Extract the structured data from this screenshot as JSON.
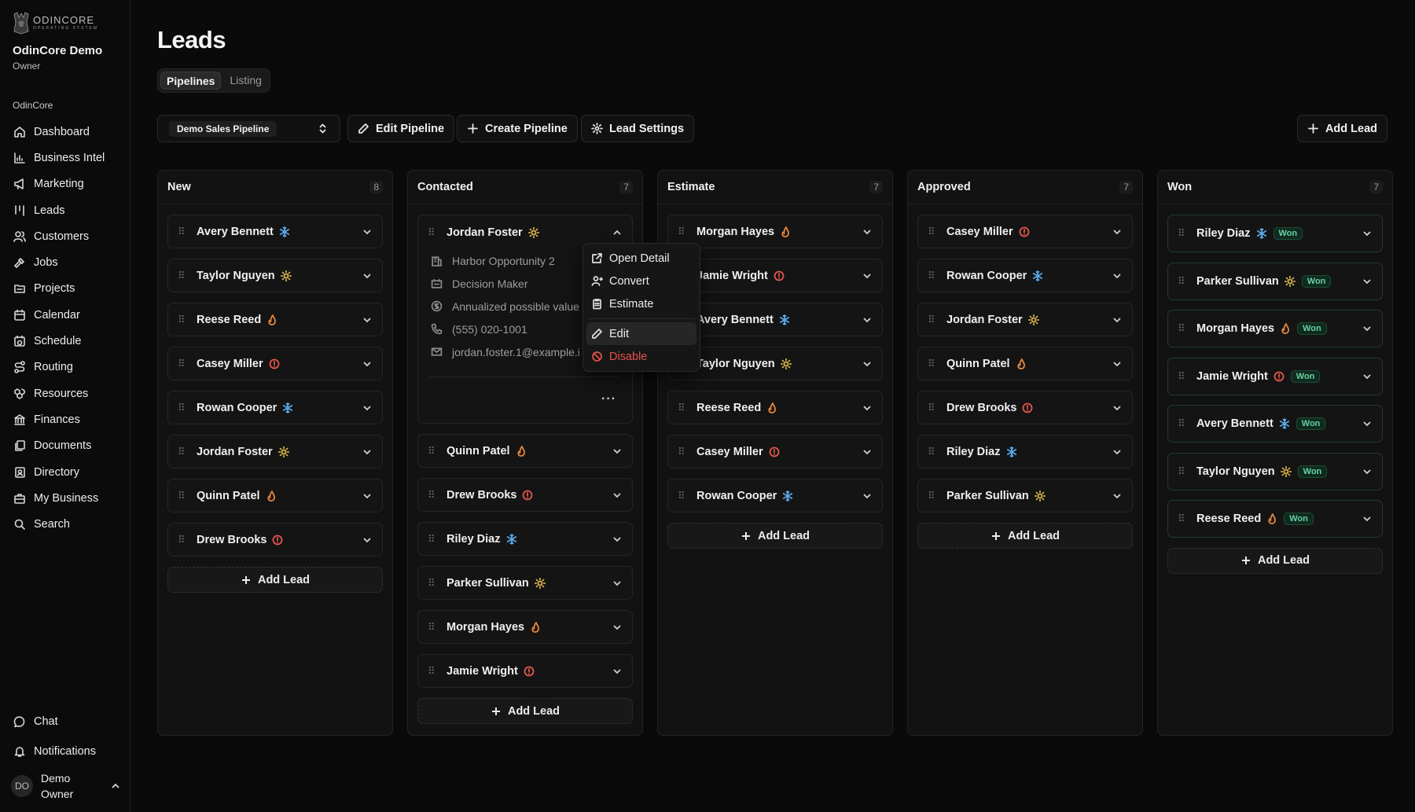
{
  "brand": {
    "logo_text": "ODINCORE",
    "logo_sub": "OPERATING SYSTEM",
    "org_name": "OdinCore Demo",
    "org_role": "Owner"
  },
  "sidebar": {
    "section": "OdinCore",
    "items": [
      {
        "label": "Dashboard",
        "icon": "home-icon"
      },
      {
        "label": "Business Intel",
        "icon": "chart-icon"
      },
      {
        "label": "Marketing",
        "icon": "megaphone-icon"
      },
      {
        "label": "Leads",
        "icon": "kanban-icon"
      },
      {
        "label": "Customers",
        "icon": "users-icon"
      },
      {
        "label": "Jobs",
        "icon": "hammer-icon"
      },
      {
        "label": "Projects",
        "icon": "folder-icon"
      },
      {
        "label": "Calendar",
        "icon": "calendar-icon"
      },
      {
        "label": "Schedule",
        "icon": "calendar-clock-icon"
      },
      {
        "label": "Routing",
        "icon": "route-icon"
      },
      {
        "label": "Resources",
        "icon": "boxes-icon"
      },
      {
        "label": "Finances",
        "icon": "bank-icon"
      },
      {
        "label": "Documents",
        "icon": "documents-icon"
      },
      {
        "label": "Directory",
        "icon": "contact-book-icon"
      },
      {
        "label": "My Business",
        "icon": "briefcase-icon"
      },
      {
        "label": "Search",
        "icon": "search-icon"
      }
    ],
    "bottom": [
      {
        "label": "Chat",
        "icon": "chat-icon"
      },
      {
        "label": "Notifications",
        "icon": "bell-icon"
      }
    ],
    "user": {
      "initials": "DO",
      "name_line1": "Demo",
      "name_line2": "Owner"
    }
  },
  "page": {
    "title": "Leads"
  },
  "view_tabs": [
    "Pipelines",
    "Listing"
  ],
  "toolbar": {
    "pipeline_value": "Demo Sales Pipeline",
    "edit_pipeline": "Edit Pipeline",
    "create_pipeline": "Create Pipeline",
    "lead_settings": "Lead Settings",
    "add_lead": "Add Lead"
  },
  "add_lead_label": "Add Lead",
  "won_badge": "Won",
  "columns": [
    {
      "title": "New",
      "count": "8",
      "cards": [
        {
          "name": "Avery Bennett",
          "status": "cold"
        },
        {
          "name": "Taylor Nguyen",
          "status": "warm"
        },
        {
          "name": "Reese Reed",
          "status": "hot"
        },
        {
          "name": "Casey Miller",
          "status": "alert"
        },
        {
          "name": "Rowan Cooper",
          "status": "cold"
        },
        {
          "name": "Jordan Foster",
          "status": "warm"
        },
        {
          "name": "Quinn Patel",
          "status": "hot"
        },
        {
          "name": "Drew Brooks",
          "status": "alert"
        }
      ]
    },
    {
      "title": "Contacted",
      "count": "7",
      "cards": [
        {
          "name": "Jordan Foster",
          "status": "warm",
          "expanded": true
        },
        {
          "name": "Quinn Patel",
          "status": "hot"
        },
        {
          "name": "Drew Brooks",
          "status": "alert"
        },
        {
          "name": "Riley Diaz",
          "status": "cold"
        },
        {
          "name": "Parker Sullivan",
          "status": "warm"
        },
        {
          "name": "Morgan Hayes",
          "status": "hot"
        },
        {
          "name": "Jamie Wright",
          "status": "alert"
        }
      ]
    },
    {
      "title": "Estimate",
      "count": "7",
      "cards": [
        {
          "name": "Morgan Hayes",
          "status": "hot"
        },
        {
          "name": "Jamie Wright",
          "status": "alert"
        },
        {
          "name": "Avery Bennett",
          "status": "cold"
        },
        {
          "name": "Taylor Nguyen",
          "status": "warm"
        },
        {
          "name": "Reese Reed",
          "status": "hot"
        },
        {
          "name": "Casey Miller",
          "status": "alert"
        },
        {
          "name": "Rowan Cooper",
          "status": "cold"
        }
      ]
    },
    {
      "title": "Approved",
      "count": "7",
      "cards": [
        {
          "name": "Casey Miller",
          "status": "alert"
        },
        {
          "name": "Rowan Cooper",
          "status": "cold"
        },
        {
          "name": "Jordan Foster",
          "status": "warm"
        },
        {
          "name": "Quinn Patel",
          "status": "hot"
        },
        {
          "name": "Drew Brooks",
          "status": "alert"
        },
        {
          "name": "Riley Diaz",
          "status": "cold"
        },
        {
          "name": "Parker Sullivan",
          "status": "warm"
        }
      ]
    },
    {
      "title": "Won",
      "count": "7",
      "won": true,
      "cards": [
        {
          "name": "Riley Diaz",
          "status": "cold"
        },
        {
          "name": "Parker Sullivan",
          "status": "warm"
        },
        {
          "name": "Morgan Hayes",
          "status": "hot"
        },
        {
          "name": "Jamie Wright",
          "status": "alert"
        },
        {
          "name": "Avery Bennett",
          "status": "cold"
        },
        {
          "name": "Taylor Nguyen",
          "status": "warm"
        },
        {
          "name": "Reese Reed",
          "status": "hot"
        }
      ]
    }
  ],
  "expanded_details": {
    "opportunity": "Harbor Opportunity 2",
    "role": "Decision Maker",
    "value": "Annualized possible value",
    "phone": "(555) 020-1001",
    "email": "jordan.foster.1@example.i"
  },
  "context_menu": [
    "Open Detail",
    "Convert",
    "Estimate",
    "Edit",
    "Disable"
  ],
  "colors": {
    "cold": "#5aa8e8",
    "warm": "#d6b14a",
    "hot": "#e8863a",
    "alert": "#e4564c",
    "won": "#68d0a1",
    "danger": "#e5534b"
  }
}
